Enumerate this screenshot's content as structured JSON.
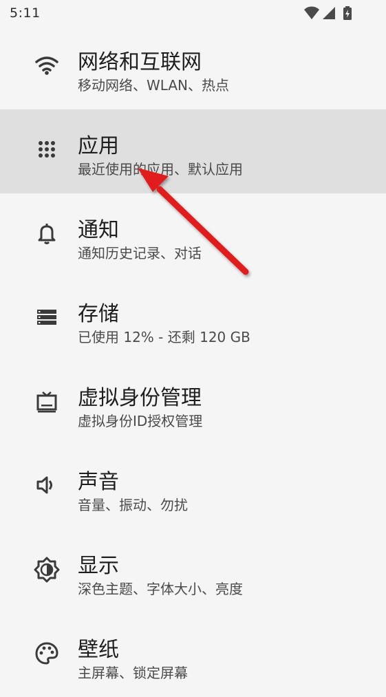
{
  "status_bar": {
    "time": "5:11",
    "icons": [
      "wifi-icon",
      "cell-signal-icon",
      "battery-charging-icon"
    ]
  },
  "settings": {
    "items": [
      {
        "title": "网络和互联网",
        "subtitle": "移动网络、WLAN、热点",
        "icon": "wifi-icon"
      },
      {
        "title": "应用",
        "subtitle": "最近使用的应用、默认应用",
        "icon": "apps-grid-icon"
      },
      {
        "title": "通知",
        "subtitle": "通知历史记录、对话",
        "icon": "bell-icon"
      },
      {
        "title": "存储",
        "subtitle": "已使用 12% - 还剩 120 GB",
        "icon": "storage-icon"
      },
      {
        "title": "虚拟身份管理",
        "subtitle": "虚拟身份ID授权管理",
        "icon": "tv-icon"
      },
      {
        "title": "声音",
        "subtitle": "音量、振动、勿扰",
        "icon": "volume-icon"
      },
      {
        "title": "显示",
        "subtitle": "深色主题、字体大小、亮度",
        "icon": "brightness-icon"
      },
      {
        "title": "壁纸",
        "subtitle": "主屏幕、锁定屏幕",
        "icon": "palette-icon"
      }
    ]
  },
  "annotation": {
    "arrow_color": "#e01e1e"
  }
}
